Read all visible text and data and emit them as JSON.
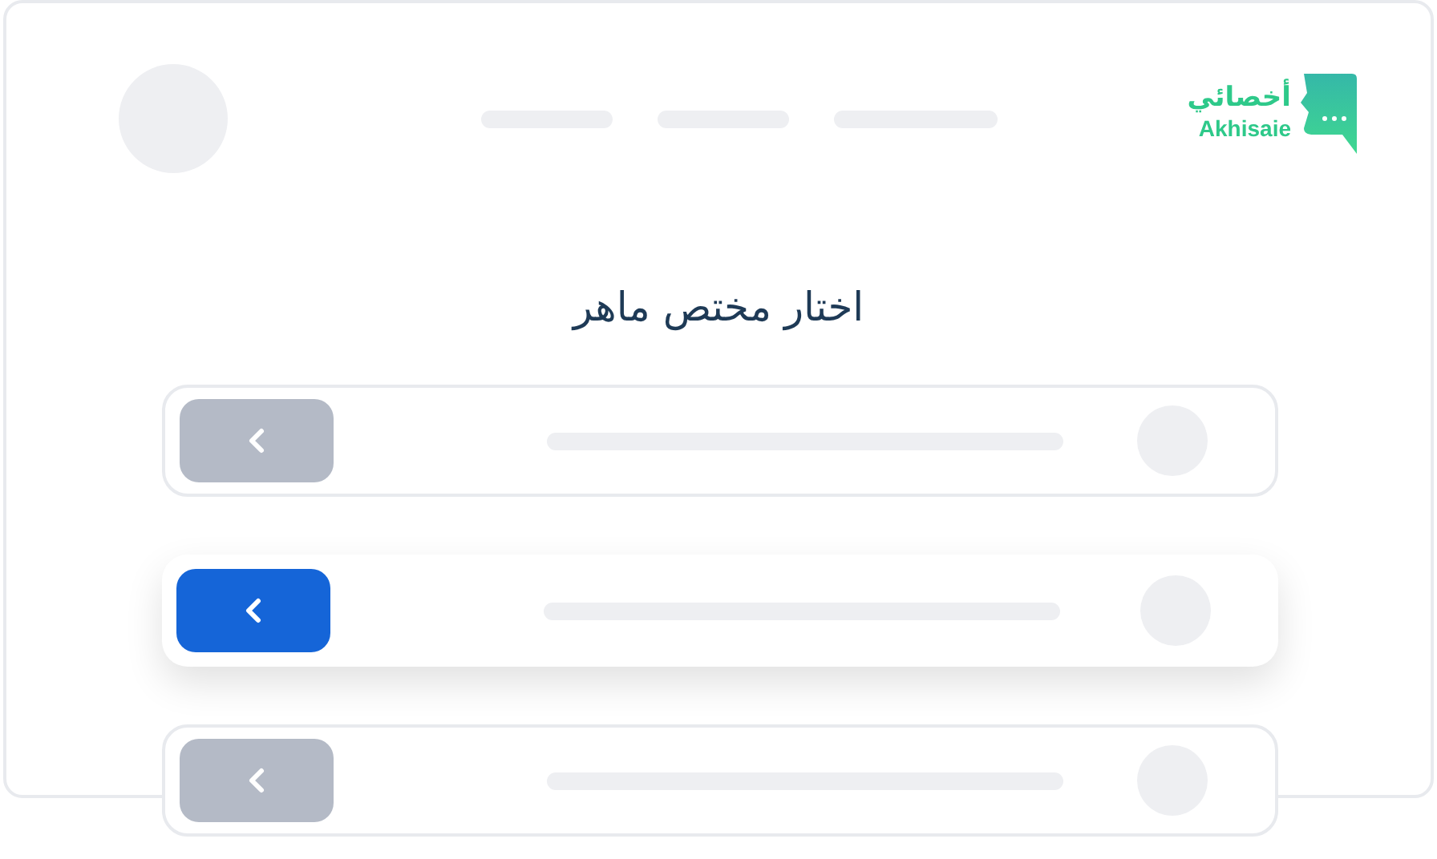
{
  "logo": {
    "arabic": "أخصائي",
    "latin": "Akhisaie"
  },
  "title": "اختار مختص ماهر",
  "rows": [
    {
      "selected": false
    },
    {
      "selected": true
    },
    {
      "selected": false
    }
  ]
}
